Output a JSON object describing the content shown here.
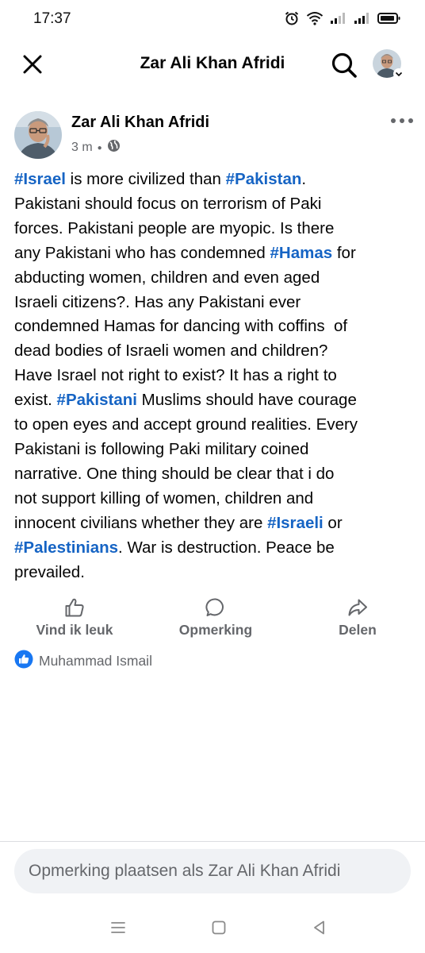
{
  "status_bar": {
    "time": "17:37"
  },
  "header": {
    "title": "Zar Ali Khan Afridi"
  },
  "post": {
    "author": "Zar Ali Khan Afridi",
    "time_ago": "3 m",
    "body": {
      "l1": {
        "h1": "#Israel",
        "t1": " is more civilized than ",
        "h2": "#Pakistan",
        "t2": "."
      },
      "l2": "Pakistani should focus on terrorism of Paki",
      "l3": "forces. Pakistani people are myopic. Is there",
      "l4": {
        "t1": "any Pakistani who has condemned ",
        "h1": "#Hamas",
        "t2": " for"
      },
      "l5": "abducting women, children and even aged",
      "l6": "Israeli citizens?. Has any Pakistani ever",
      "l7": "condemned Hamas for dancing with coffins  of",
      "l8": "dead bodies of Israeli women and children?",
      "l9": "Have Israel not right to exist? It has a right to",
      "l10": {
        "t1": "exist. ",
        "h1": "#Pakistani",
        "t2": " Muslims should have courage"
      },
      "l11": "to open eyes and accept ground realities. Every",
      "l12": "Pakistani is following Paki military coined",
      "l13": "narrative. One thing should be clear that i do",
      "l14": "not support killing of women, children and",
      "l15": {
        "t1": "innocent civilians whether they are ",
        "h1": "#Israeli",
        "t2": " or"
      },
      "l16": {
        "h1": "#Palestinians",
        "t1": ". War is destruction. Peace be"
      },
      "l17": "prevailed."
    }
  },
  "actions": {
    "like": "Vind ik leuk",
    "comment": "Opmerking",
    "share": "Delen"
  },
  "reactions": {
    "name": "Muhammad Ismail"
  },
  "composer": {
    "placeholder": "Opmerking plaatsen als Zar Ali Khan Afridi"
  },
  "colors": {
    "hashtag": "#1664c4",
    "secondary_text": "#65676b",
    "like_badge": "#1877f2"
  }
}
